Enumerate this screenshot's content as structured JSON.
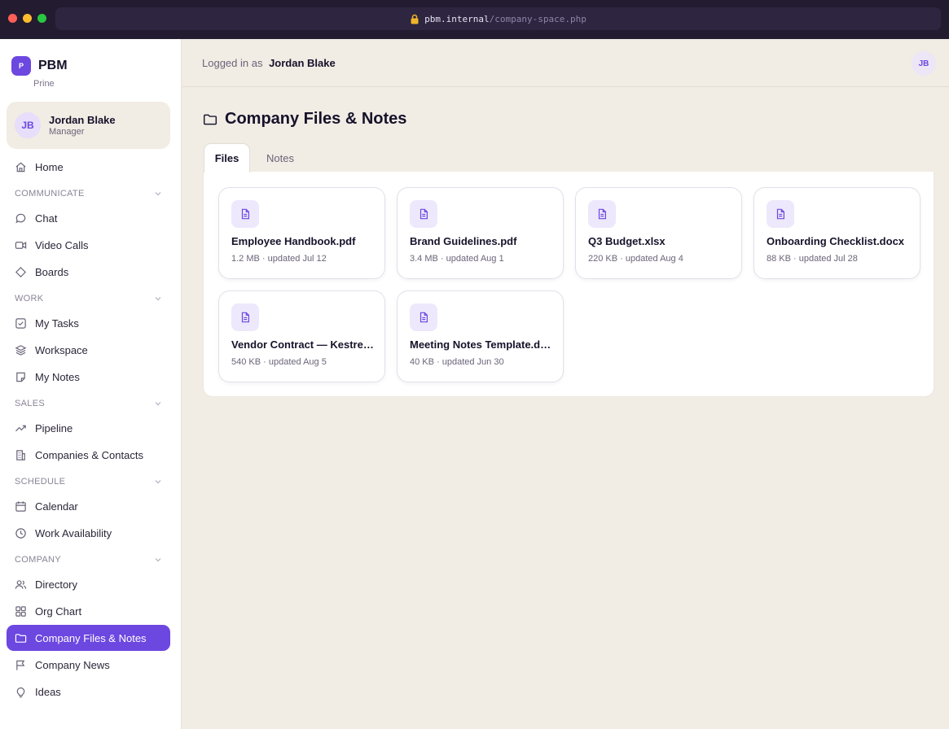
{
  "browser": {
    "url_host": "pbm.internal",
    "url_path": "/company-space.php"
  },
  "brand": {
    "logo_letter": "P",
    "name": "PBM",
    "subtitle": "Prine"
  },
  "user": {
    "initials": "JB",
    "name": "Jordan Blake",
    "role": "Manager"
  },
  "nav": {
    "home": "Home",
    "sections": {
      "communicate": "COMMUNICATE",
      "work": "WORK",
      "sales": "SALES",
      "schedule": "SCHEDULE",
      "company": "COMPANY"
    },
    "items": {
      "chat": "Chat",
      "video_calls": "Video Calls",
      "boards": "Boards",
      "my_tasks": "My Tasks",
      "workspace": "Workspace",
      "my_notes": "My Notes",
      "pipeline": "Pipeline",
      "companies_contacts": "Companies & Contacts",
      "calendar": "Calendar",
      "work_availability": "Work Availability",
      "directory": "Directory",
      "org_chart": "Org Chart",
      "company_files_notes": "Company Files & Notes",
      "company_news": "Company News",
      "ideas": "Ideas"
    },
    "active": "company_files_notes"
  },
  "topbar": {
    "logged_in_label": "Logged in as",
    "user_name": "Jordan Blake",
    "avatar_initials": "JB"
  },
  "page": {
    "title": "Company Files & Notes",
    "tabs": {
      "files": "Files",
      "notes": "Notes"
    },
    "active_tab": "files"
  },
  "files": [
    {
      "name": "Employee Handbook.pdf",
      "meta": "1.2 MB · updated Jul 12"
    },
    {
      "name": "Brand Guidelines.pdf",
      "meta": "3.4 MB · updated Aug 1"
    },
    {
      "name": "Q3 Budget.xlsx",
      "meta": "220 KB · updated Aug 4"
    },
    {
      "name": "Onboarding Checklist.docx",
      "meta": "88 KB · updated Jul 28"
    },
    {
      "name": "Vendor Contract — Kestrel Supply.pdf",
      "meta": "540 KB · updated Aug 5"
    },
    {
      "name": "Meeting Notes Template.docx",
      "meta": "40 KB · updated Jun 30"
    }
  ],
  "colors": {
    "accent": "#6c47e0",
    "background": "#f1ece4",
    "chrome": "#231b30"
  }
}
